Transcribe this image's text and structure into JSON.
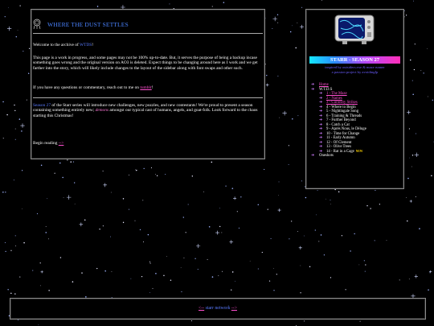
{
  "site": {
    "title": "WHERE THE DUST SETTLES"
  },
  "main": {
    "welcome_prefix": "Welcome to the archive of ",
    "welcome_link": "WTDS",
    "welcome_suffix": "!",
    "para1": "This page is a work in progress, and some pages may not be 100% up-to-date. But, it serves the purpose of being a backup incase something goes wrong and the original version on AO3 is deleted. Expect things to be changing around here as I work and we get farther into the story, which will likely include changes to the layout of the sidebar along with font swaps and other such.",
    "contact_prefix": "If you have any questions or commentary, reach out to me on ",
    "contact_link": "tumblr",
    "contact_suffix": "!",
    "season_link": "Season 27",
    "season_text_a": " of the Starr series will introduce new challenges, new puzzles, and new contestants! We're proud to present a season containing something entirely new; ",
    "season_em": "demons",
    "season_text_b": " amongst our typical cast of humans, angels, and goat-folk. Look forward to the chaos starting this Christmas!",
    "begin_label": "Begin reading ",
    "begin_link": "-->"
  },
  "sidebar": {
    "tv_icon": "tv-icon",
    "season_title": "STARR - SEASON 27",
    "inspired_line1": "inspired by outsiders.exe & maze runner",
    "inspired_line2": "a passion project by avoidingIp",
    "nav_top": [
      {
        "label": "Home",
        "link": true
      },
      {
        "label": "W.T.D.S",
        "link": false
      }
    ],
    "chapters": [
      {
        "label": "1 - The Maze",
        "link": true
      },
      {
        "label": "2 - Names",
        "link": true
      },
      {
        "label": "3 - Curiosity Strikes",
        "link": true
      },
      {
        "label": "4 - Where to Begin",
        "link": false
      },
      {
        "label": "5 - Nightingale Song",
        "link": false
      },
      {
        "label": "6 - Training & Threads",
        "link": false
      },
      {
        "label": "7 - Further Beyond",
        "link": false
      },
      {
        "label": "8 - Catch a Cat",
        "link": false
      },
      {
        "label": "9 - Aprés Nous, le Déluge",
        "link": false
      },
      {
        "label": "10 - Time for Change",
        "link": false
      },
      {
        "label": "11 - Early Autumn",
        "link": false
      },
      {
        "label": "12 - Of Clement",
        "link": false
      },
      {
        "label": "13 - Olive Trees",
        "link": false
      },
      {
        "label": "14 - Rat in a Cage",
        "link": false,
        "badge": "NEW"
      }
    ],
    "nav_bottom": [
      {
        "label": "Oneshots",
        "link": false
      }
    ]
  },
  "footer": {
    "prev": "<--",
    "label": " starr network ",
    "next": "-->"
  },
  "colors": {
    "background": "#000000",
    "accent_blue": "#4a83ff",
    "accent_pink": "#ff4fd0",
    "panel_border": "#8a8a8a"
  }
}
